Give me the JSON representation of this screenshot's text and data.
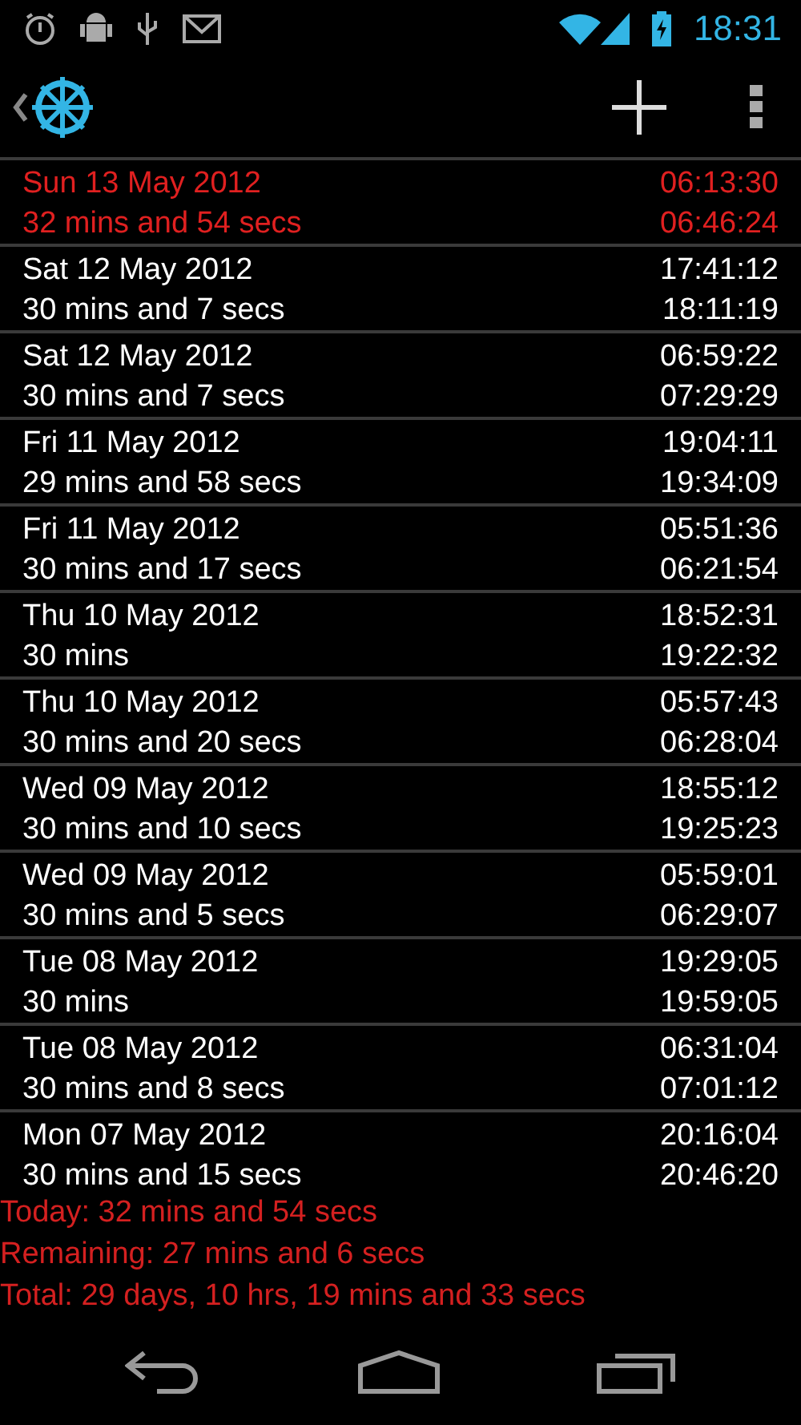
{
  "status_bar": {
    "time": "18:31"
  },
  "sessions": [
    {
      "date": "Sun 13 May 2012",
      "duration": "32 mins and 54 secs",
      "start": "06:13:30",
      "end": "06:46:24",
      "highlighted": true
    },
    {
      "date": "Sat 12 May 2012",
      "duration": "30 mins and 7 secs",
      "start": "17:41:12",
      "end": "18:11:19",
      "highlighted": false
    },
    {
      "date": "Sat 12 May 2012",
      "duration": "30 mins and 7 secs",
      "start": "06:59:22",
      "end": "07:29:29",
      "highlighted": false
    },
    {
      "date": "Fri 11 May 2012",
      "duration": "29 mins and 58 secs",
      "start": "19:04:11",
      "end": "19:34:09",
      "highlighted": false
    },
    {
      "date": "Fri 11 May 2012",
      "duration": "30 mins and 17 secs",
      "start": "05:51:36",
      "end": "06:21:54",
      "highlighted": false
    },
    {
      "date": "Thu 10 May 2012",
      "duration": "30 mins",
      "start": "18:52:31",
      "end": "19:22:32",
      "highlighted": false
    },
    {
      "date": "Thu 10 May 2012",
      "duration": "30 mins and 20 secs",
      "start": "05:57:43",
      "end": "06:28:04",
      "highlighted": false
    },
    {
      "date": "Wed 09 May 2012",
      "duration": "30 mins and 10 secs",
      "start": "18:55:12",
      "end": "19:25:23",
      "highlighted": false
    },
    {
      "date": "Wed 09 May 2012",
      "duration": "30 mins and 5 secs",
      "start": "05:59:01",
      "end": "06:29:07",
      "highlighted": false
    },
    {
      "date": "Tue 08 May 2012",
      "duration": "30 mins",
      "start": "19:29:05",
      "end": "19:59:05",
      "highlighted": false
    },
    {
      "date": "Tue 08 May 2012",
      "duration": "30 mins and 8 secs",
      "start": "06:31:04",
      "end": "07:01:12",
      "highlighted": false
    },
    {
      "date": "Mon 07 May 2012",
      "duration": "30 mins and 15 secs",
      "start": "20:16:04",
      "end": "20:46:20",
      "highlighted": false
    }
  ],
  "summary": [
    "Today: 32 mins and 54 secs",
    "Remaining: 27 mins and 6 secs",
    "Total: 29 days, 10 hrs, 19 mins and 33 secs"
  ]
}
